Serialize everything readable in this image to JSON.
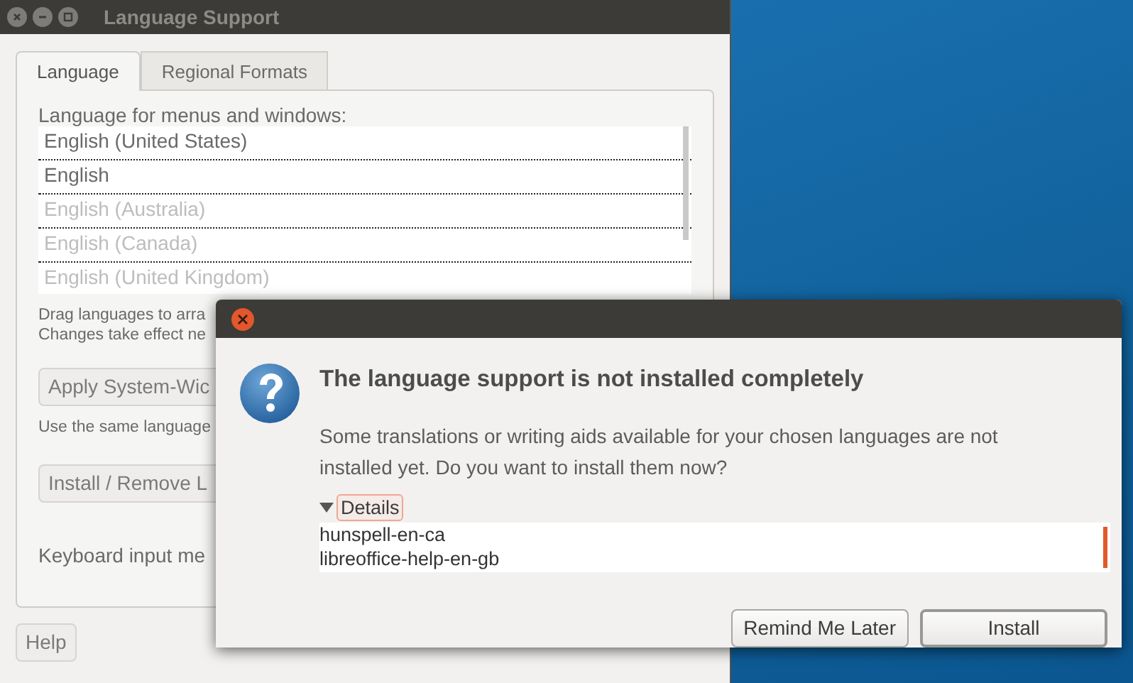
{
  "main_window": {
    "title": "Language Support",
    "tabs": [
      {
        "label": "Language",
        "selected": true
      },
      {
        "label": "Regional Formats",
        "selected": false
      }
    ],
    "list_label": "Language for menus and windows:",
    "languages": [
      {
        "name": "English (United States)",
        "disabled": false
      },
      {
        "name": "English",
        "disabled": false
      },
      {
        "name": "English (Australia)",
        "disabled": true
      },
      {
        "name": "English (Canada)",
        "disabled": true
      },
      {
        "name": "English (United Kingdom)",
        "disabled": true
      }
    ],
    "hint_lines": [
      "Drag languages to arra",
      "Changes take effect ne"
    ],
    "apply_button": "Apply System-Wic",
    "apply_hint": "Use the same language",
    "install_button": "Install / Remove L",
    "keyboard_label": "Keyboard input me",
    "help_button": "Help"
  },
  "dialog": {
    "heading": "The language support is not installed completely",
    "message": "Some translations or writing aids available for your chosen languages are not installed yet. Do you want to install them now?",
    "details": {
      "label": "Details",
      "expanded": true,
      "packages": [
        "hunspell-en-ca",
        "libreoffice-help-en-gb"
      ]
    },
    "buttons": [
      {
        "label": "Remind Me Later",
        "default": false
      },
      {
        "label": "Install",
        "default": true
      }
    ]
  }
}
